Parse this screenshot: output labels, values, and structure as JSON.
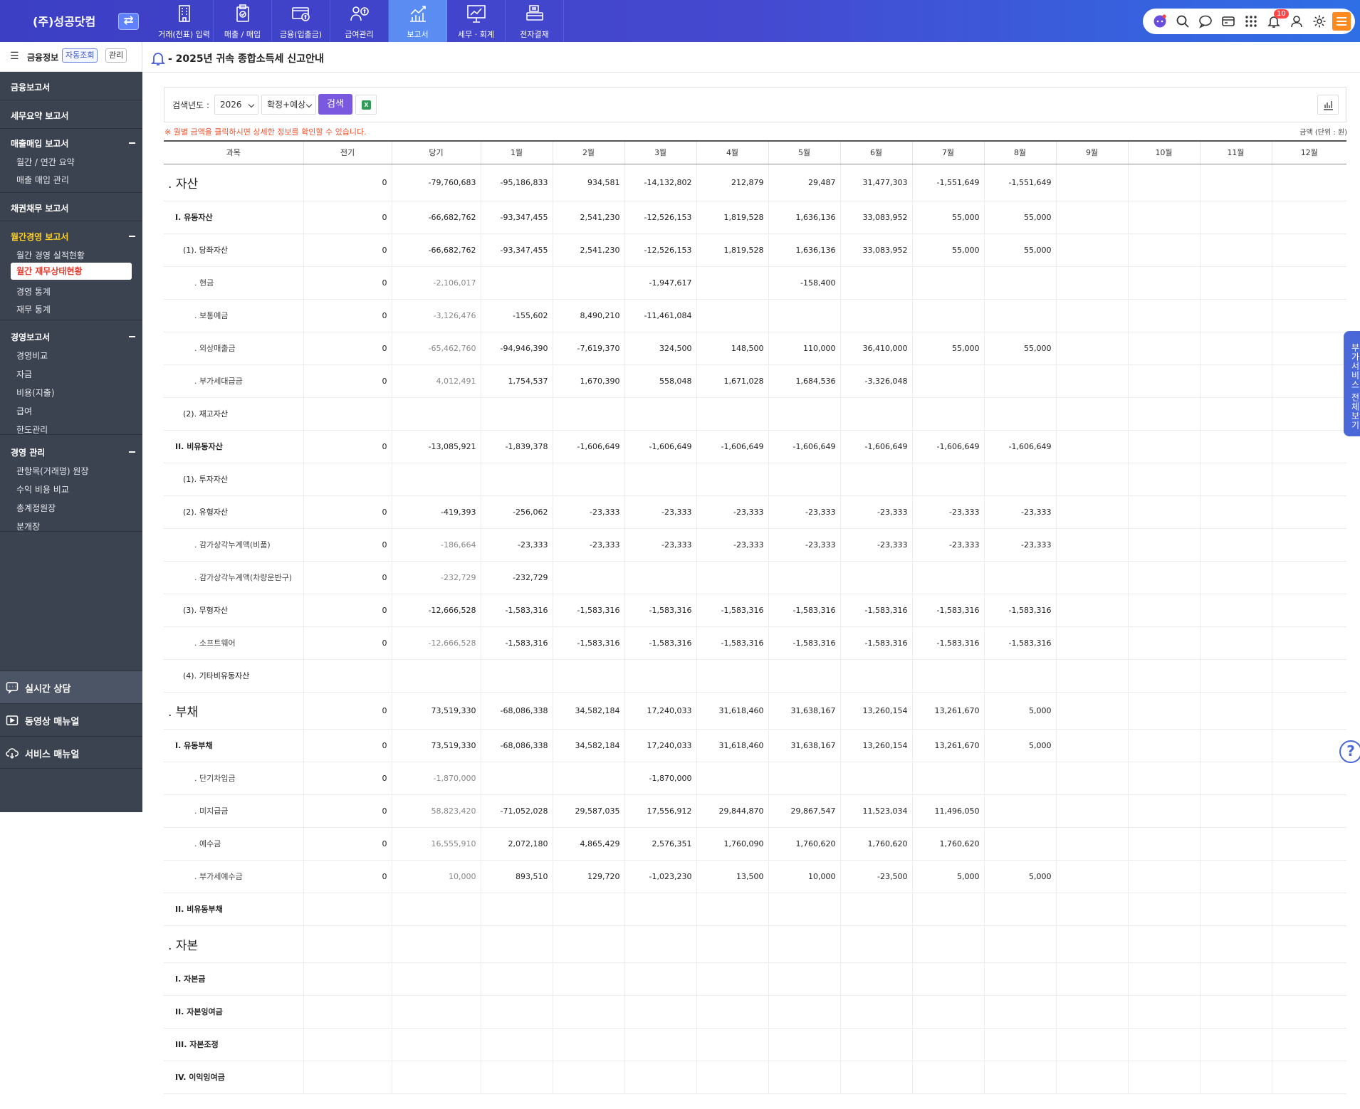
{
  "header": {
    "company": "(주)성공닷컴",
    "nav": [
      {
        "label": "거래(전표) 입력",
        "icon": "building-icon"
      },
      {
        "label": "매출 / 매입",
        "icon": "clipboard-check-icon"
      },
      {
        "label": "금융(입출금)",
        "icon": "money-card-icon"
      },
      {
        "label": "급여관리",
        "icon": "payroll-icon"
      },
      {
        "label": "보고서",
        "icon": "report-chart-icon"
      },
      {
        "label": "세무 · 회계",
        "icon": "presentation-chart-icon"
      },
      {
        "label": "전자결재",
        "icon": "approval-icon"
      }
    ],
    "active_nav": "보고서",
    "notification_count": "10"
  },
  "sidebar": {
    "finance_title": "금융정보",
    "auto_label": "자동조회",
    "manage_label": "관리",
    "sections": {
      "finance_report": "금융보고서",
      "tax_summary": "세무요약 보고서",
      "sales_purchase": {
        "title": "매출매입 보고서",
        "items": [
          "월간 / 연간 요약",
          "매출 매입 관리"
        ]
      },
      "receivable": "채권채무 보고서",
      "monthly": {
        "title": "월간경영 보고서",
        "items": [
          "월간 경영 실적현황",
          "월간 재무상태현황",
          "경영 통계",
          "재무 통계"
        ]
      },
      "business": {
        "title": "경영보고서",
        "items": [
          "경영비교",
          "자금",
          "비용(지출)",
          "급여",
          "한도관리"
        ]
      },
      "management": {
        "title": "경영 관리",
        "items": [
          "관항목(거래명) 원장",
          "수익 비용 비교",
          "총계정원장",
          "분개장"
        ]
      }
    },
    "support": [
      "실시간 상담",
      "동영상 매뉴얼",
      "서비스 매뉴얼"
    ]
  },
  "notice": "- 2025년 귀속 종합소득세 신고안내",
  "search": {
    "year_label": "검색년도 :",
    "year": "2026",
    "type": "확정+예상",
    "button": "검색",
    "excel": "X"
  },
  "hint": "※ 월별 금액을 클릭하시면 상세한 정보를 확인할 수 있습니다.",
  "unit": "금액 (단위 : 원)",
  "side_tab": "부가서비스 전체보기",
  "help": "?",
  "table": {
    "headers": [
      "과목",
      "전기",
      "당기",
      "1월",
      "2월",
      "3월",
      "4월",
      "5월",
      "6월",
      "7월",
      "8월",
      "9월",
      "10월",
      "11월",
      "12월"
    ],
    "rows": [
      {
        "level": 0,
        "h": 52,
        "cells": [
          ". 자산",
          "0",
          "-79,760,683",
          "-95,186,833",
          "934,581",
          "-14,132,802",
          "212,879",
          "29,487",
          "31,477,303",
          "-1,551,649",
          "-1,551,649",
          "",
          "",
          "",
          ""
        ]
      },
      {
        "level": 1,
        "h": 46,
        "bold": true,
        "cells": [
          "I. 유동자산",
          "0",
          "-66,682,762",
          "-93,347,455",
          "2,541,230",
          "-12,526,153",
          "1,819,528",
          "1,636,136",
          "33,083,952",
          "55,000",
          "55,000",
          "",
          "",
          "",
          ""
        ]
      },
      {
        "level": 2,
        "h": 46,
        "cells": [
          "(1). 당좌자산",
          "0",
          "-66,682,762",
          "-93,347,455",
          "2,541,230",
          "-12,526,153",
          "1,819,528",
          "1,636,136",
          "33,083,952",
          "55,000",
          "55,000",
          "",
          "",
          "",
          ""
        ]
      },
      {
        "level": 3,
        "h": 46,
        "cells": [
          ". 현금",
          "0",
          "-2,106,017",
          "",
          "",
          "-1,947,617",
          "",
          "-158,400",
          "",
          "",
          "",
          "",
          "",
          "",
          ""
        ]
      },
      {
        "level": 3,
        "h": 46,
        "cells": [
          ". 보통예금",
          "0",
          "-3,126,476",
          "-155,602",
          "8,490,210",
          "-11,461,084",
          "",
          "",
          "",
          "",
          "",
          "",
          "",
          "",
          ""
        ]
      },
      {
        "level": 3,
        "h": 46,
        "cells": [
          ". 외상매출금",
          "0",
          "-65,462,760",
          "-94,946,390",
          "-7,619,370",
          "324,500",
          "148,500",
          "110,000",
          "36,410,000",
          "55,000",
          "55,000",
          "",
          "",
          "",
          ""
        ]
      },
      {
        "level": 3,
        "h": 46,
        "cells": [
          ". 부가세대급금",
          "0",
          "4,012,491",
          "1,754,537",
          "1,670,390",
          "558,048",
          "1,671,028",
          "1,684,536",
          "-3,326,048",
          "",
          "",
          "",
          "",
          "",
          ""
        ]
      },
      {
        "level": 2,
        "h": 46,
        "cells": [
          "(2). 재고자산",
          "",
          "",
          "",
          "",
          "",
          "",
          "",
          "",
          "",
          "",
          "",
          "",
          "",
          ""
        ]
      },
      {
        "level": 1,
        "h": 46,
        "bold": true,
        "cells": [
          "II. 비유동자산",
          "0",
          "-13,085,921",
          "-1,839,378",
          "-1,606,649",
          "-1,606,649",
          "-1,606,649",
          "-1,606,649",
          "-1,606,649",
          "-1,606,649",
          "-1,606,649",
          "",
          "",
          "",
          ""
        ]
      },
      {
        "level": 2,
        "h": 46,
        "cells": [
          "(1). 투자자산",
          "",
          "",
          "",
          "",
          "",
          "",
          "",
          "",
          "",
          "",
          "",
          "",
          "",
          ""
        ]
      },
      {
        "level": 2,
        "h": 46,
        "cells": [
          "(2). 유형자산",
          "0",
          "-419,393",
          "-256,062",
          "-23,333",
          "-23,333",
          "-23,333",
          "-23,333",
          "-23,333",
          "-23,333",
          "-23,333",
          "",
          "",
          "",
          ""
        ]
      },
      {
        "level": 3,
        "h": 46,
        "cells": [
          ". 감가상각누계액(비품)",
          "0",
          "-186,664",
          "-23,333",
          "-23,333",
          "-23,333",
          "-23,333",
          "-23,333",
          "-23,333",
          "-23,333",
          "-23,333",
          "",
          "",
          "",
          ""
        ]
      },
      {
        "level": 3,
        "h": 46,
        "cells": [
          ". 감가상각누계액(차량운반구)",
          "0",
          "-232,729",
          "-232,729",
          "",
          "",
          "",
          "",
          "",
          "",
          "",
          "",
          "",
          "",
          ""
        ]
      },
      {
        "level": 2,
        "h": 46,
        "cells": [
          "(3). 무형자산",
          "0",
          "-12,666,528",
          "-1,583,316",
          "-1,583,316",
          "-1,583,316",
          "-1,583,316",
          "-1,583,316",
          "-1,583,316",
          "-1,583,316",
          "-1,583,316",
          "",
          "",
          "",
          ""
        ]
      },
      {
        "level": 3,
        "h": 46,
        "cells": [
          ". 소프트웨어",
          "0",
          "-12,666,528",
          "-1,583,316",
          "-1,583,316",
          "-1,583,316",
          "-1,583,316",
          "-1,583,316",
          "-1,583,316",
          "-1,583,316",
          "-1,583,316",
          "",
          "",
          "",
          ""
        ]
      },
      {
        "level": 2,
        "h": 46,
        "cells": [
          "(4). 기타비유동자산",
          "",
          "",
          "",
          "",
          "",
          "",
          "",
          "",
          "",
          "",
          "",
          "",
          "",
          ""
        ]
      },
      {
        "level": 0,
        "h": 52,
        "cells": [
          ". 부채",
          "0",
          "73,519,330",
          "-68,086,338",
          "34,582,184",
          "17,240,033",
          "31,618,460",
          "31,638,167",
          "13,260,154",
          "13,261,670",
          "5,000",
          "",
          "",
          "",
          ""
        ]
      },
      {
        "level": 1,
        "h": 46,
        "bold": true,
        "cells": [
          "I. 유동부채",
          "0",
          "73,519,330",
          "-68,086,338",
          "34,582,184",
          "17,240,033",
          "31,618,460",
          "31,638,167",
          "13,260,154",
          "13,261,670",
          "5,000",
          "",
          "",
          "",
          ""
        ]
      },
      {
        "level": 3,
        "h": 46,
        "cells": [
          ". 단기차입금",
          "0",
          "-1,870,000",
          "",
          "",
          "-1,870,000",
          "",
          "",
          "",
          "",
          "",
          "",
          "",
          "",
          ""
        ]
      },
      {
        "level": 3,
        "h": 46,
        "cells": [
          ". 미지급금",
          "0",
          "58,823,420",
          "-71,052,028",
          "29,587,035",
          "17,556,912",
          "29,844,870",
          "29,867,547",
          "11,523,034",
          "11,496,050",
          "",
          "",
          "",
          "",
          ""
        ]
      },
      {
        "level": 3,
        "h": 46,
        "cells": [
          ". 예수금",
          "0",
          "16,555,910",
          "2,072,180",
          "4,865,429",
          "2,576,351",
          "1,760,090",
          "1,760,620",
          "1,760,620",
          "1,760,620",
          "",
          "",
          "",
          "",
          ""
        ]
      },
      {
        "level": 3,
        "h": 46,
        "cells": [
          ". 부가세예수금",
          "0",
          "10,000",
          "893,510",
          "129,720",
          "-1,023,230",
          "13,500",
          "10,000",
          "-23,500",
          "5,000",
          "5,000",
          "",
          "",
          "",
          ""
        ]
      },
      {
        "level": 1,
        "h": 46,
        "bold": true,
        "cells": [
          "II. 비유동부채",
          "",
          "",
          "",
          "",
          "",
          "",
          "",
          "",
          "",
          "",
          "",
          "",
          "",
          ""
        ]
      },
      {
        "level": 0,
        "h": 52,
        "cells": [
          ". 자본",
          "",
          "",
          "",
          "",
          "",
          "",
          "",
          "",
          "",
          "",
          "",
          "",
          "",
          ""
        ]
      },
      {
        "level": 1,
        "h": 46,
        "bold": true,
        "cells": [
          "I. 자본금",
          "",
          "",
          "",
          "",
          "",
          "",
          "",
          "",
          "",
          "",
          "",
          "",
          "",
          ""
        ]
      },
      {
        "level": 1,
        "h": 46,
        "bold": true,
        "cells": [
          "II. 자본잉여금",
          "",
          "",
          "",
          "",
          "",
          "",
          "",
          "",
          "",
          "",
          "",
          "",
          "",
          ""
        ]
      },
      {
        "level": 1,
        "h": 46,
        "bold": true,
        "cells": [
          "III. 자본조정",
          "",
          "",
          "",
          "",
          "",
          "",
          "",
          "",
          "",
          "",
          "",
          "",
          "",
          ""
        ]
      },
      {
        "level": 1,
        "h": 46,
        "bold": true,
        "cells": [
          "IV. 이익잉여금",
          "",
          "",
          "",
          "",
          "",
          "",
          "",
          "",
          "",
          "",
          "",
          "",
          "",
          ""
        ]
      }
    ]
  }
}
